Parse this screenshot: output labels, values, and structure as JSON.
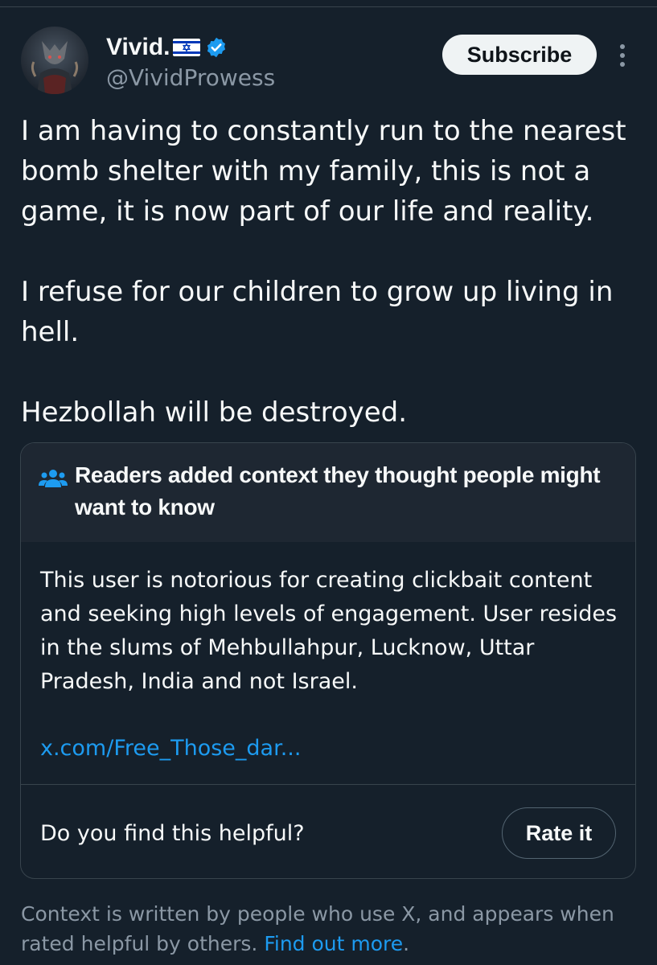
{
  "author": {
    "display_name": "Vivid.",
    "handle": "@VividProwess",
    "flag_icon": "israel-flag-icon",
    "verified_icon": "verified-badge-icon",
    "verified_color": "#1d9bf0"
  },
  "actions": {
    "subscribe_label": "Subscribe",
    "more_icon": "more-vertical-icon"
  },
  "tweet": {
    "paragraphs": [
      "I am having to constantly run to the nearest bomb shelter with my family, this is not a game, it is now part of our life and reality.",
      "I refuse for our children to grow up living in hell.",
      "Hezbollah will be destroyed."
    ]
  },
  "community_note": {
    "icon": "people-icon",
    "title": "Readers added context they thought people might want to know",
    "body": "This user is notorious for creating clickbait content and seeking high levels of engagement. User resides in the slums of Mehbullahpur, Lucknow, Uttar Pradesh, India and not Israel.",
    "link_text": "x.com/Free_Those_dar...",
    "helpful_question": "Do you find this helpful?",
    "rate_label": "Rate it"
  },
  "footer": {
    "text": "Context is written by people who use X, and appears when rated helpful by others.",
    "link_text": "Find out more",
    "trailing": "."
  },
  "colors": {
    "background": "#15202b",
    "note_header_bg": "#1e2732",
    "border": "#38444d",
    "accent": "#1d9bf0",
    "secondary_text": "#8b98a5"
  }
}
